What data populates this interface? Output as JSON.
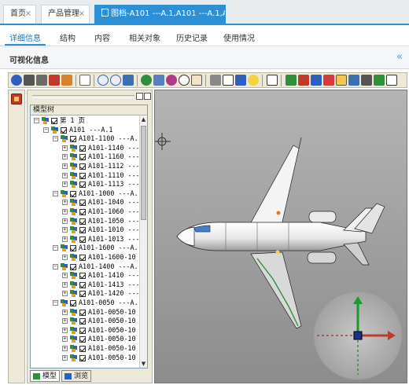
{
  "tabs": [
    {
      "label": "首页",
      "close": "×"
    },
    {
      "label": "产品管理",
      "close": "×"
    },
    {
      "label": "图档-A101 ---A.1,A101 ---A.1,A.1",
      "close": ""
    }
  ],
  "subtabs": [
    "详细信息",
    "结构",
    "内容",
    "相关对象",
    "历史记录",
    "使用情况"
  ],
  "section": {
    "title": "可视化信息",
    "collapse_glyph": "«"
  },
  "tree_panel": {
    "header": "模型树",
    "bottom_tabs": [
      "模型",
      "浏览"
    ]
  },
  "tree": [
    {
      "level": 0,
      "text": "第 1 页",
      "exp": "⊟"
    },
    {
      "level": 1,
      "text": "A101 ---A.1",
      "exp": "⊟"
    },
    {
      "level": 2,
      "text": "A101-1100 ---A.",
      "exp": "⊟"
    },
    {
      "level": 3,
      "text": "A101-1140 ---",
      "exp": "⊞"
    },
    {
      "level": 3,
      "text": "A101-1160 ---",
      "exp": "⊞"
    },
    {
      "level": 3,
      "text": "A101-1112 ---",
      "exp": "⊞"
    },
    {
      "level": 3,
      "text": "A101-1110 ---",
      "exp": "⊞"
    },
    {
      "level": 3,
      "text": "A101-1113 ---",
      "exp": "⊞"
    },
    {
      "level": 2,
      "text": "A101-1000 ---A.",
      "exp": "⊟"
    },
    {
      "level": 3,
      "text": "A101-1040 ---",
      "exp": "⊞"
    },
    {
      "level": 3,
      "text": "A101-1060 ---",
      "exp": "⊞"
    },
    {
      "level": 3,
      "text": "A101-1050 ---",
      "exp": "⊞"
    },
    {
      "level": 3,
      "text": "A101-1010 ---",
      "exp": "⊞"
    },
    {
      "level": 3,
      "text": "A101-1013 ---",
      "exp": "⊞"
    },
    {
      "level": 2,
      "text": "A101-1600 ---A.",
      "exp": "⊟"
    },
    {
      "level": 3,
      "text": "A101-1600-10",
      "exp": "⊞"
    },
    {
      "level": 2,
      "text": "A101-1400 ---A.",
      "exp": "⊟"
    },
    {
      "level": 3,
      "text": "A101-1410 ---",
      "exp": "⊞"
    },
    {
      "level": 3,
      "text": "A101-1413 ---",
      "exp": "⊞"
    },
    {
      "level": 3,
      "text": "A101-1420 ---",
      "exp": "⊞"
    },
    {
      "level": 2,
      "text": "A101-0050 ---A.",
      "exp": "⊟"
    },
    {
      "level": 3,
      "text": "A101-0050-10",
      "exp": "⊞"
    },
    {
      "level": 3,
      "text": "A101-0050-10",
      "exp": "⊞"
    },
    {
      "level": 3,
      "text": "A101-0050-10",
      "exp": "⊞"
    },
    {
      "level": 3,
      "text": "A101-0050-10",
      "exp": "⊞"
    },
    {
      "level": 3,
      "text": "A101-0050-10",
      "exp": "⊞"
    },
    {
      "level": 3,
      "text": "A101-0050-10",
      "exp": "⊞"
    }
  ],
  "colors": {
    "accent": "#2d8fd5",
    "viewport_bg": "#9a9a9a"
  }
}
